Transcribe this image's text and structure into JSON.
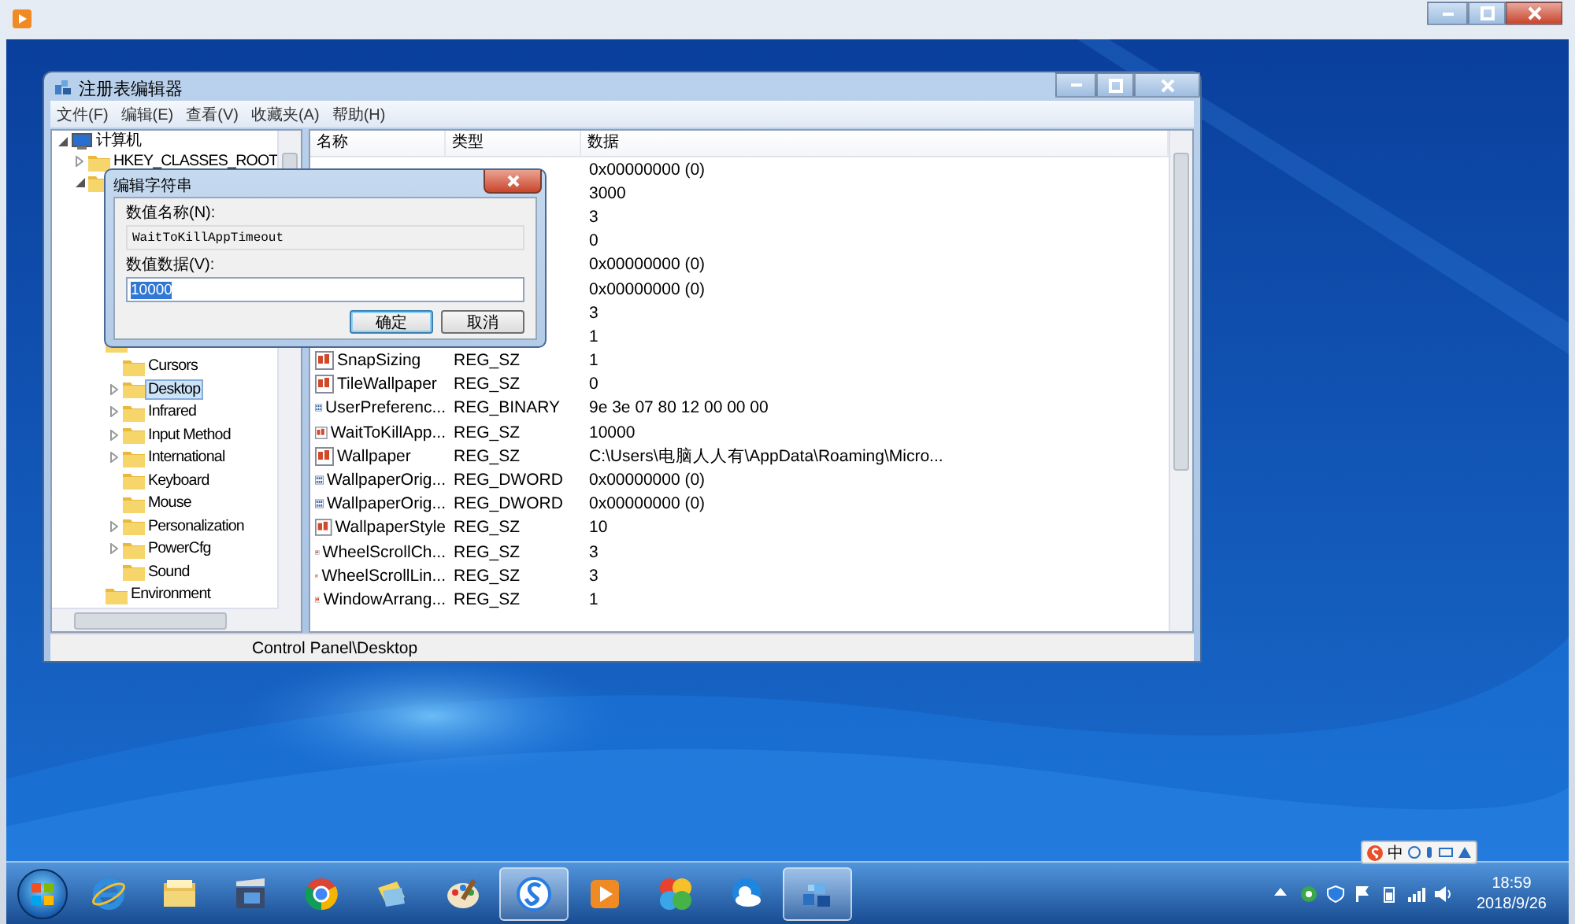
{
  "regedit": {
    "title": "注册表编辑器",
    "menu": [
      "文件(F)",
      "编辑(E)",
      "查看(V)",
      "收藏夹(A)",
      "帮助(H)"
    ],
    "tree": {
      "label": "计算机",
      "expanded": true,
      "selected": false,
      "children": [
        {
          "label": "HKEY_CLASSES_ROOT",
          "expanded": false,
          "selected": false
        },
        {
          "expanded": true,
          "children": [
            {
              "children": [
                {
                  "label": "Cursors",
                  "selected": false
                },
                {
                  "label": "Desktop",
                  "expanded": false,
                  "selected": true
                },
                {
                  "label": "Infrared",
                  "expanded": false,
                  "selected": false
                },
                {
                  "label": "Input Method",
                  "expanded": false,
                  "selected": false
                },
                {
                  "label": "International",
                  "expanded": false,
                  "selected": false
                },
                {
                  "label": "Keyboard",
                  "selected": false
                },
                {
                  "label": "Mouse",
                  "selected": false
                },
                {
                  "label": "Personalization",
                  "expanded": false,
                  "selected": false
                },
                {
                  "label": "PowerCfg",
                  "expanded": false,
                  "selected": false
                },
                {
                  "label": "Sound",
                  "selected": false
                }
              ]
            },
            {
              "label": "Environment",
              "selected": false
            }
          ]
        }
      ]
    },
    "columns": [
      "名称",
      "类型",
      "数据"
    ],
    "rows": [
      {
        "data": "0x00000000 (0)"
      },
      {
        "data": "3000"
      },
      {
        "data": "3"
      },
      {
        "data": "0"
      },
      {
        "data": "0x00000000 (0)"
      },
      {
        "data": "0x00000000 (0)"
      },
      {
        "data": "3"
      },
      {
        "data": "1"
      },
      {
        "kind": "string",
        "name": "SnapSizing",
        "type": "REG_SZ",
        "data": "1"
      },
      {
        "kind": "string",
        "name": "TileWallpaper",
        "type": "REG_SZ",
        "data": "0"
      },
      {
        "kind": "binary",
        "name": "UserPreferenc...",
        "type": "REG_BINARY",
        "data": "9e 3e 07 80 12 00 00 00"
      },
      {
        "kind": "string",
        "name": "WaitToKillApp...",
        "type": "REG_SZ",
        "data": "10000"
      },
      {
        "kind": "string",
        "name": "Wallpaper",
        "type": "REG_SZ",
        "data": "C:\\Users\\电脑人人有\\AppData\\Roaming\\Micro..."
      },
      {
        "kind": "binary",
        "name": "WallpaperOrig...",
        "type": "REG_DWORD",
        "data": "0x00000000 (0)"
      },
      {
        "kind": "binary",
        "name": "WallpaperOrig...",
        "type": "REG_DWORD",
        "data": "0x00000000 (0)"
      },
      {
        "kind": "string",
        "name": "WallpaperStyle",
        "type": "REG_SZ",
        "data": "10"
      },
      {
        "kind": "string",
        "name": "WheelScrollCh...",
        "type": "REG_SZ",
        "data": "3"
      },
      {
        "kind": "string",
        "name": "WheelScrollLin...",
        "type": "REG_SZ",
        "data": "3"
      },
      {
        "kind": "string",
        "name": "WindowArrang...",
        "type": "REG_SZ",
        "data": "1"
      }
    ],
    "status_bar": "Control Panel\\Desktop"
  },
  "dialog": {
    "title": "编辑字符串",
    "name_label": "数值名称(N):",
    "name_value": "WaitToKillAppTimeout",
    "data_label": "数值数据(V):",
    "data_value": "10000",
    "data_selected": true,
    "buttons": [
      {
        "label": "确定",
        "default": true
      },
      {
        "label": "取消",
        "default": false
      }
    ]
  },
  "taskbar": {
    "apps": [
      {
        "kind": "ie",
        "active": false
      },
      {
        "kind": "explorer",
        "active": false
      },
      {
        "kind": "media",
        "active": false
      },
      {
        "kind": "chrome",
        "active": false
      },
      {
        "kind": "notes",
        "active": false
      },
      {
        "kind": "paint",
        "active": false
      },
      {
        "kind": "sogou",
        "active": true
      },
      {
        "kind": "player",
        "active": false
      },
      {
        "kind": "pinwheel",
        "active": false
      },
      {
        "kind": "cloud",
        "active": false
      },
      {
        "kind": "regedit",
        "active": true
      }
    ],
    "ime": "中",
    "clock_time": "18:59",
    "clock_date": "2018/9/26"
  }
}
